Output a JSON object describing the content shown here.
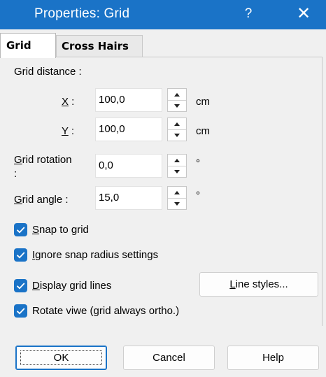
{
  "window": {
    "title": "Properties: Grid",
    "help_icon": "?",
    "close_icon": "✕",
    "accent_color": "#1a73c7"
  },
  "tabs": [
    {
      "label": "Grid",
      "active": true
    },
    {
      "label": "Cross Hairs",
      "active": false
    }
  ],
  "grid_distance": {
    "section_label": "Grid distance :",
    "x": {
      "mnemonic": "X",
      "rest": " :",
      "value": "100,0",
      "unit": "cm"
    },
    "y": {
      "mnemonic": "Y",
      "rest": " :",
      "value": "100,0",
      "unit": "cm"
    }
  },
  "grid_rotation": {
    "label_line1_mnemonic": "G",
    "label_line1_rest": "rid rotation",
    "label_line2": ":",
    "value": "0,0",
    "unit": "°"
  },
  "grid_angle": {
    "mnemonic": "G",
    "rest": "rid angle :",
    "value": "15,0",
    "unit": "°"
  },
  "checkboxes": [
    {
      "mnemonic": "S",
      "rest": "nap to grid",
      "checked": true
    },
    {
      "mnemonic": "I",
      "rest": "gnore snap radius settings",
      "checked": true
    },
    {
      "mnemonic": "D",
      "rest": "isplay grid lines",
      "checked": true
    },
    {
      "mnemonic": "",
      "rest": "Rotate viwe (grid always ortho.)",
      "checked": true
    }
  ],
  "line_styles_button": {
    "mnemonic": "L",
    "rest": "ine styles..."
  },
  "footer_buttons": {
    "ok": "OK",
    "cancel": "Cancel",
    "help": "Help"
  }
}
